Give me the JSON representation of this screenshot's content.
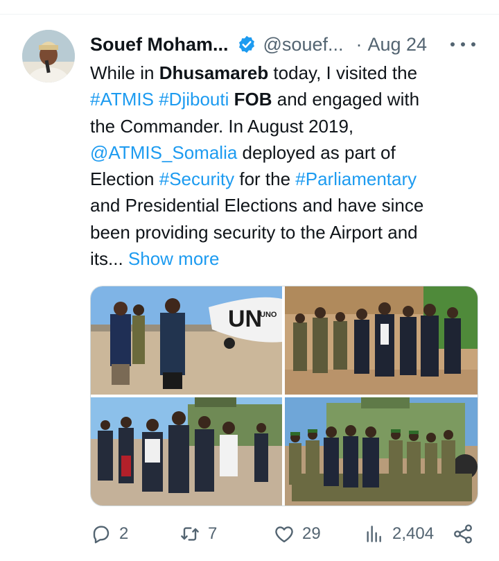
{
  "tweet": {
    "author": {
      "display_name": "Souef Moham...",
      "handle": "@souef...",
      "verified": true,
      "avatar_icon": "profile-photo"
    },
    "separator": "·",
    "date": "Aug 24",
    "text": {
      "t1": "While in ",
      "t2": "Dhusamareb",
      "t3": " today, I visited the",
      "t4": "#ATMIS",
      "t5": " ",
      "t6": "#Djibouti",
      "t7": " ",
      "t8": "FOB",
      "t9": " and engaged with",
      "t10": "the Commander.  In August 2019,",
      "t11": "@ATMIS_Somalia",
      "t12": " deployed as part of",
      "t13": "Election ",
      "t14": "#Security",
      "t15": " for the ",
      "t16": "#Parliamentary",
      "t17": "and Presidential Elections and have since",
      "t18": "been providing security to the Airport and",
      "t19": "its... ",
      "t20": "Show more"
    },
    "media": {
      "photos": [
        {
          "name": "handshake-airport",
          "plane_label": "UN",
          "plane_sublabel": "UNO"
        },
        {
          "name": "walking-courtyard"
        },
        {
          "name": "walking-armored-vehicle"
        },
        {
          "name": "group-photo-vehicle"
        }
      ]
    },
    "stats": {
      "replies": "2",
      "reposts": "7",
      "likes": "29",
      "views": "2,404"
    }
  },
  "colors": {
    "link": "#1d9bf0",
    "text": "#0f1419",
    "muted": "#536471",
    "verified": "#1d9bf0",
    "border": "#cfd9de"
  }
}
